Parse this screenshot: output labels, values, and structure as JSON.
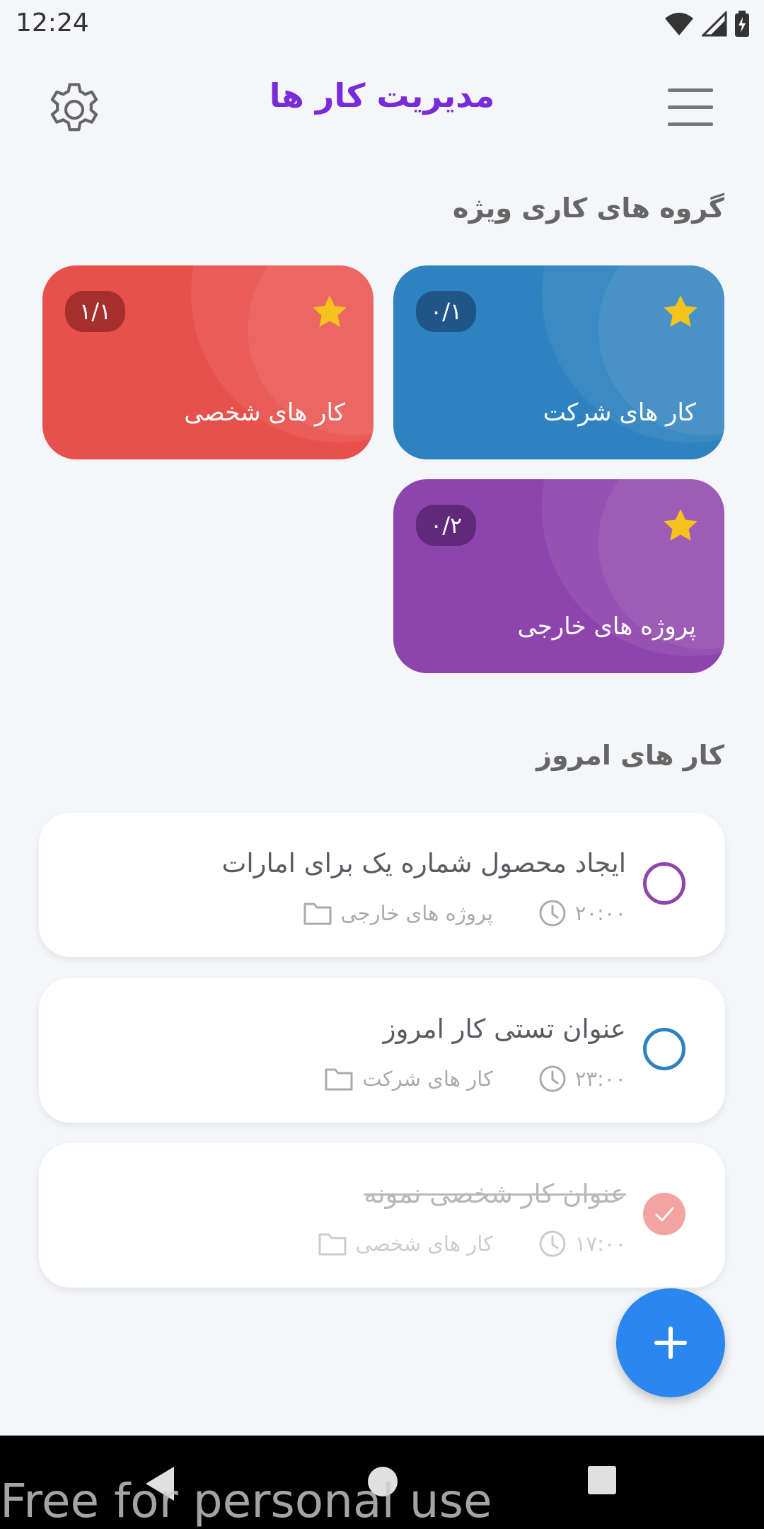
{
  "status_bar": {
    "time": "12:24"
  },
  "app_bar": {
    "title": "مدیریت کار ها"
  },
  "groups_section": {
    "title": "گروه های کاری ویژه",
    "cards": [
      {
        "name": "کار های شرکت",
        "count": "۰/۱",
        "color": "#2e82bf",
        "icon": "star-icon"
      },
      {
        "name": "کار های شخصی",
        "count": "۱/۱",
        "color": "#e8504b",
        "icon": "star-icon"
      },
      {
        "name": "پروژه های خارجی",
        "count": "۰/۲",
        "color": "#8e44ad",
        "icon": "star-icon"
      }
    ]
  },
  "today_section": {
    "title": "کار های امروز",
    "tasks": [
      {
        "title": "ایجاد محصول شماره یک برای امارات",
        "group": "پروژه های خارجی",
        "time": "۲۰:۰۰",
        "done": false,
        "color": "#8e44ad"
      },
      {
        "title": "عنوان تستی کار امروز",
        "group": "کار های شرکت",
        "time": "۲۳:۰۰",
        "done": false,
        "color": "#2e82bf"
      },
      {
        "title": "عنوان کار شخصی نمونه",
        "group": "کار های شخصی",
        "time": "۱۷:۰۰",
        "done": true,
        "color": "#f4a3a3"
      }
    ]
  },
  "watermark": "Free for personal use"
}
